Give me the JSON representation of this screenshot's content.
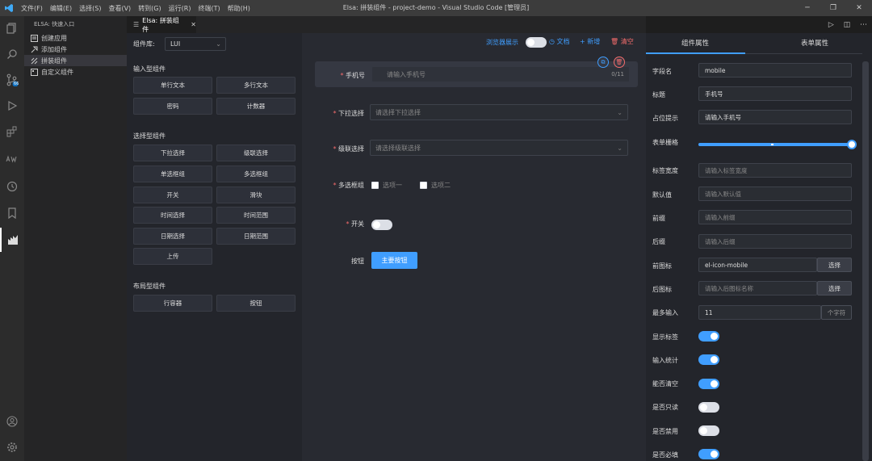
{
  "titlebar": {
    "menus": [
      "文件(F)",
      "编辑(E)",
      "选择(S)",
      "查看(V)",
      "转到(G)",
      "运行(R)",
      "终端(T)",
      "帮助(H)"
    ],
    "window_title": "Elsa: 拼装组件 - project-demo - Visual Studio Code [管理员]"
  },
  "activity": {
    "badge": "66"
  },
  "sidebar": {
    "header": "ELSA: 快速入口",
    "items": [
      {
        "label": "创建应用"
      },
      {
        "label": "添加组件"
      },
      {
        "label": "拼装组件"
      },
      {
        "label": "自定义组件"
      }
    ]
  },
  "tab": {
    "label": "Elsa: 拼装组件",
    "close": "✕"
  },
  "toolbar": {
    "library_label": "组件库:",
    "library_value": "LUI",
    "browser_preview": "浏览器展示",
    "docs": "文档",
    "add": "新增",
    "clear": "清空"
  },
  "palette": {
    "input_title": "输入型组件",
    "input_items": [
      "单行文本",
      "多行文本",
      "密码",
      "计数器"
    ],
    "select_title": "选择型组件",
    "select_items": [
      "下拉选择",
      "级联选择",
      "单选框组",
      "多选框组",
      "开关",
      "滑块",
      "时间选择",
      "时间范围",
      "日期选择",
      "日期范围",
      "上传"
    ],
    "layout_title": "布局型组件",
    "layout_items": [
      "行容器",
      "按钮"
    ]
  },
  "form": {
    "phone": {
      "label": "手机号",
      "placeholder": "请输入手机号",
      "count": "0/11"
    },
    "dropdown": {
      "label": "下拉选择",
      "placeholder": "请选择下拉选择"
    },
    "cascader": {
      "label": "级联选择",
      "placeholder": "请选择级联选择"
    },
    "checkbox": {
      "label": "多选框组",
      "opt1": "选项一",
      "opt2": "选项二"
    },
    "switch": {
      "label": "开关"
    },
    "button": {
      "label": "按钮",
      "text": "主要按钮"
    }
  },
  "props": {
    "tab_component": "组件属性",
    "tab_form": "表单属性",
    "field_name": {
      "label": "字段名",
      "value": "mobile"
    },
    "title": {
      "label": "标题",
      "value": "手机号"
    },
    "placeholder": {
      "label": "占位提示",
      "value": "请输入手机号"
    },
    "grid": {
      "label": "表单栅格",
      "value": 24,
      "max": 24
    },
    "label_width": {
      "label": "标签宽度",
      "placeholder": "请输入标签宽度"
    },
    "default_value": {
      "label": "默认值",
      "placeholder": "请输入默认值"
    },
    "prefix": {
      "label": "前缀",
      "placeholder": "请输入前缀"
    },
    "suffix": {
      "label": "后缀",
      "placeholder": "请输入后缀"
    },
    "prefix_icon": {
      "label": "前图标",
      "value": "el-icon-mobile",
      "button": "选择"
    },
    "suffix_icon": {
      "label": "后图标",
      "placeholder": "请输入后图标名称",
      "button": "选择"
    },
    "max_input": {
      "label": "最多输入",
      "value": "11",
      "unit": "个字符"
    },
    "show_label": {
      "label": "显示标签",
      "on": true
    },
    "show_count": {
      "label": "输入统计",
      "on": true
    },
    "clearable": {
      "label": "能否清空",
      "on": true
    },
    "readonly": {
      "label": "是否只读",
      "on": false
    },
    "disabled": {
      "label": "是否禁用",
      "on": false
    },
    "required": {
      "label": "是否必填",
      "on": true
    }
  },
  "colors": {
    "accent": "#409eff",
    "danger": "#f56c6c"
  }
}
